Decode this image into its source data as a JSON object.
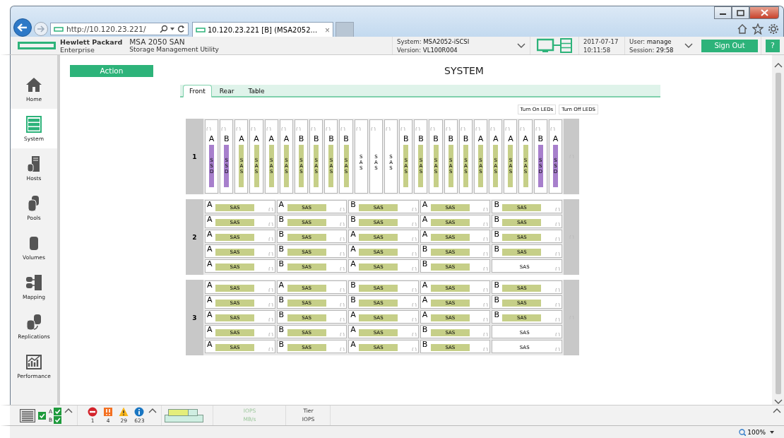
{
  "browser": {
    "address": "http://10.120.23.221/",
    "tab_title": "10.120.23.221 [B] (MSA2052...",
    "tab_close": "×"
  },
  "header": {
    "brand_line_1": "Hewlett Packard",
    "brand_line_2": "Enterprise",
    "product": "MSA 2050 SAN",
    "subtitle": "Storage Management Utility",
    "system": "System: **MSA2052-iSCSI**",
    "version": "Version: **VL100R004**",
    "date": "2017-07-17",
    "time": "10:11:58",
    "user": "User: **manage**",
    "session": "Session: **29:58**",
    "sign_out": "Sign Out",
    "help": "?"
  },
  "sidebar": {
    "items": [
      {
        "label": "Home",
        "kind": "home",
        "selected": false
      },
      {
        "label": "System",
        "kind": "system",
        "selected": true
      },
      {
        "label": "Hosts",
        "kind": "hosts",
        "selected": false
      },
      {
        "label": "Pools",
        "kind": "pools",
        "selected": false
      },
      {
        "label": "Volumes",
        "kind": "volumes",
        "selected": false
      },
      {
        "label": "Mapping",
        "kind": "mapping",
        "selected": false
      },
      {
        "label": "Replications",
        "kind": "replications",
        "selected": false
      },
      {
        "label": "Performance",
        "kind": "performance",
        "selected": false
      }
    ]
  },
  "action_button": "Action",
  "page_title": "SYSTEM",
  "tabs": [
    {
      "label": "Front",
      "selected": true
    },
    {
      "label": "Rear",
      "selected": false
    },
    {
      "label": "Table",
      "selected": false
    }
  ],
  "led_buttons": [
    "Turn On LEDs",
    "Turn Off LEDS"
  ],
  "enclosures": [
    {
      "number": "1",
      "kind": "vertical",
      "disks": [
        {
          "owner": "A",
          "type": "SSD",
          "color": "#a77fcc"
        },
        {
          "owner": "B",
          "type": "SSD",
          "color": "#a77fcc"
        },
        {
          "owner": "A",
          "type": "SAS",
          "color": "#c6cf88"
        },
        {
          "owner": "A",
          "type": "SAS",
          "color": "#c6cf88"
        },
        {
          "owner": "A",
          "type": "SAS",
          "color": "#c6cf88"
        },
        {
          "owner": "A",
          "type": "SAS",
          "color": "#c6cf88"
        },
        {
          "owner": "B",
          "type": "SAS",
          "color": "#c6cf88"
        },
        {
          "owner": "B",
          "type": "SAS",
          "color": "#c6cf88"
        },
        {
          "owner": "B",
          "type": "SAS",
          "color": "#c6cf88"
        },
        {
          "owner": "B",
          "type": "SAS",
          "color": "#c6cf88"
        },
        {
          "type": "SAS"
        },
        {
          "type": "SAS"
        },
        {
          "type": "SAS"
        },
        {
          "owner": "B",
          "type": "SAS",
          "color": "#c6cf88"
        },
        {
          "owner": "B",
          "type": "SAS",
          "color": "#c6cf88"
        },
        {
          "owner": "B",
          "type": "SAS",
          "color": "#c6cf88"
        },
        {
          "owner": "B",
          "type": "SAS",
          "color": "#c6cf88"
        },
        {
          "owner": "B",
          "type": "SAS",
          "color": "#c6cf88"
        },
        {
          "owner": "A",
          "type": "SAS",
          "color": "#c6cf88"
        },
        {
          "owner": "A",
          "type": "SAS",
          "color": "#c6cf88"
        },
        {
          "owner": "A",
          "type": "SAS",
          "color": "#c6cf88"
        },
        {
          "owner": "A",
          "type": "SAS",
          "color": "#c6cf88"
        },
        {
          "owner": "B",
          "type": "SSD",
          "color": "#a77fcc"
        },
        {
          "owner": "A",
          "type": "SSD",
          "color": "#a77fcc"
        }
      ]
    },
    {
      "number": "2",
      "kind": "horizontal",
      "disks": [
        {
          "owner": "A",
          "type": "SAS",
          "color": "#c6cf88"
        },
        {
          "owner": "A",
          "type": "SAS",
          "color": "#c6cf88"
        },
        {
          "owner": "B",
          "type": "SAS",
          "color": "#c6cf88"
        },
        {
          "owner": "A",
          "type": "SAS",
          "color": "#c6cf88"
        },
        {
          "owner": "B",
          "type": "SAS",
          "color": "#c6cf88"
        },
        {
          "owner": "A",
          "type": "SAS",
          "color": "#c6cf88"
        },
        {
          "owner": "B",
          "type": "SAS",
          "color": "#c6cf88"
        },
        {
          "owner": "B",
          "type": "SAS",
          "color": "#c6cf88"
        },
        {
          "owner": "A",
          "type": "SAS",
          "color": "#c6cf88"
        },
        {
          "owner": "B",
          "type": "SAS",
          "color": "#c6cf88"
        },
        {
          "owner": "A",
          "type": "SAS",
          "color": "#c6cf88"
        },
        {
          "owner": "B",
          "type": "SAS",
          "color": "#c6cf88"
        },
        {
          "owner": "A",
          "type": "SAS",
          "color": "#c6cf88"
        },
        {
          "owner": "A",
          "type": "SAS",
          "color": "#c6cf88"
        },
        {
          "owner": "B",
          "type": "SAS",
          "color": "#c6cf88"
        },
        {
          "owner": "A",
          "type": "SAS",
          "color": "#c6cf88"
        },
        {
          "owner": "B",
          "type": "SAS",
          "color": "#c6cf88"
        },
        {
          "owner": "A",
          "type": "SAS",
          "color": "#c6cf88"
        },
        {
          "owner": "B",
          "type": "SAS",
          "color": "#c6cf88"
        },
        {
          "owner": "B",
          "type": "SAS",
          "color": "#c6cf88"
        },
        {
          "owner": "A",
          "type": "SAS",
          "color": "#c6cf88"
        },
        {
          "owner": "B",
          "type": "SAS",
          "color": "#c6cf88"
        },
        {
          "owner": "A",
          "type": "SAS",
          "color": "#c6cf88"
        },
        {
          "owner": "B",
          "type": "SAS",
          "color": "#c6cf88"
        },
        {
          "type": "SAS"
        }
      ]
    },
    {
      "number": "3",
      "kind": "horizontal",
      "disks": [
        {
          "owner": "A",
          "type": "SAS",
          "color": "#c6cf88"
        },
        {
          "owner": "A",
          "type": "SAS",
          "color": "#c6cf88"
        },
        {
          "owner": "B",
          "type": "SAS",
          "color": "#c6cf88"
        },
        {
          "owner": "A",
          "type": "SAS",
          "color": "#c6cf88"
        },
        {
          "owner": "B",
          "type": "SAS",
          "color": "#c6cf88"
        },
        {
          "owner": "A",
          "type": "SAS",
          "color": "#c6cf88"
        },
        {
          "owner": "B",
          "type": "SAS",
          "color": "#c6cf88"
        },
        {
          "owner": "B",
          "type": "SAS",
          "color": "#c6cf88"
        },
        {
          "owner": "A",
          "type": "SAS",
          "color": "#c6cf88"
        },
        {
          "owner": "B",
          "type": "SAS",
          "color": "#c6cf88"
        },
        {
          "owner": "A",
          "type": "SAS",
          "color": "#c6cf88"
        },
        {
          "owner": "B",
          "type": "SAS",
          "color": "#c6cf88"
        },
        {
          "owner": "A",
          "type": "SAS",
          "color": "#c6cf88"
        },
        {
          "owner": "A",
          "type": "SAS",
          "color": "#c6cf88"
        },
        {
          "owner": "B",
          "type": "SAS",
          "color": "#c6cf88"
        },
        {
          "owner": "A",
          "type": "SAS",
          "color": "#c6cf88"
        },
        {
          "owner": "B",
          "type": "SAS",
          "color": "#c6cf88"
        },
        {
          "owner": "A",
          "type": "SAS",
          "color": "#c6cf88"
        },
        {
          "owner": "B",
          "type": "SAS",
          "color": "#c6cf88"
        },
        {
          "type": "SAS"
        },
        {
          "owner": "A",
          "type": "SAS",
          "color": "#c6cf88"
        },
        {
          "owner": "B",
          "type": "SAS",
          "color": "#c6cf88"
        },
        {
          "owner": "A",
          "type": "SAS",
          "color": "#c6cf88"
        },
        {
          "owner": "B",
          "type": "SAS",
          "color": "#c6cf88"
        },
        {
          "type": "SAS"
        }
      ]
    }
  ],
  "footer": {
    "system_ok": true,
    "controllers": [
      {
        "label": "A",
        "ok": true
      },
      {
        "label": "B",
        "ok": true
      }
    ],
    "alerts": [
      {
        "kind": "critical",
        "count": "1"
      },
      {
        "kind": "error",
        "count": "4"
      },
      {
        "kind": "warning",
        "count": "29"
      },
      {
        "kind": "info",
        "count": "623"
      }
    ],
    "perf_1": [
      "IOPS",
      "MB/s"
    ],
    "perf_2": [
      "Tier",
      "IOPS"
    ]
  },
  "status_bar": {
    "zoom": "100%"
  }
}
